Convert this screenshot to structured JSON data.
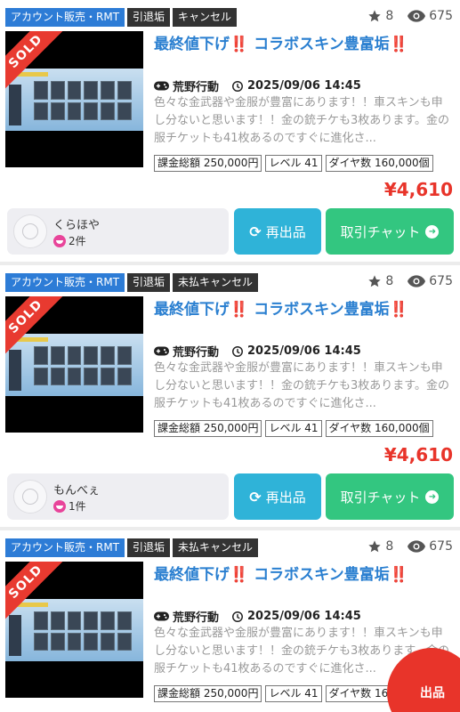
{
  "listings": [
    {
      "tags": [
        "アカウント販売・RMT",
        "引退垢",
        "キャンセル"
      ],
      "favorites": "8",
      "views": "675",
      "sold_badge": "SOLD",
      "title": "最終値下げ‼️ コラボスキン豊富垢‼️",
      "game": "荒野行動",
      "datetime": "2025/09/06 14:45",
      "description": "色々な金武器や金服が豊富にあります！！車スキンも申し分ないと思います！！金の銃チケも3枚あります。金の服チケットも41枚あるのですぐに進化さ...",
      "specs": [
        "課金総額 250,000円",
        "レベル 41",
        "ダイヤ数 160,000個"
      ],
      "price": "¥4,610",
      "seller_name": "くらほや",
      "seller_reviews": "2件",
      "relist_label": "再出品",
      "chat_label": "取引チャット"
    },
    {
      "tags": [
        "アカウント販売・RMT",
        "引退垢",
        "未払キャンセル"
      ],
      "favorites": "8",
      "views": "675",
      "sold_badge": "SOLD",
      "title": "最終値下げ‼️ コラボスキン豊富垢‼️",
      "game": "荒野行動",
      "datetime": "2025/09/06 14:45",
      "description": "色々な金武器や金服が豊富にあります！！車スキンも申し分ないと思います！！金の銃チケも3枚あります。金の服チケットも41枚あるのですぐに進化さ...",
      "specs": [
        "課金総額 250,000円",
        "レベル 41",
        "ダイヤ数 160,000個"
      ],
      "price": "¥4,610",
      "seller_name": "もんべぇ",
      "seller_reviews": "1件",
      "relist_label": "再出品",
      "chat_label": "取引チャット"
    },
    {
      "tags": [
        "アカウント販売・RMT",
        "引退垢",
        "未払キャンセル"
      ],
      "favorites": "8",
      "views": "675",
      "sold_badge": "SOLD",
      "title": "最終値下げ‼️ コラボスキン豊富垢‼️",
      "game": "荒野行動",
      "datetime": "2025/09/06 14:45",
      "description": "色々な金武器や金服が豊富にあります！！車スキンも申し分ないと思います！！金の銃チケも3枚あります。金の服チケットも41枚あるのですぐに進化さ...",
      "specs": [
        "課金総額 250,000円",
        "レベル 41",
        "ダイヤ数 160,000個"
      ]
    }
  ],
  "fab_label": "出品",
  "colors": {
    "title": "#2a7fd0",
    "price": "#e8342a",
    "relist": "#2fb3d8",
    "chat": "#33c680",
    "tag_blue": "#2d7cd6",
    "tag_dark": "#333333"
  },
  "icons": {
    "favorites": "star-icon",
    "views": "eye-icon",
    "game": "gamepad-icon",
    "datetime": "clock-history-icon",
    "relist": "refresh-icon",
    "chat": "arrow-circle-right-icon"
  }
}
